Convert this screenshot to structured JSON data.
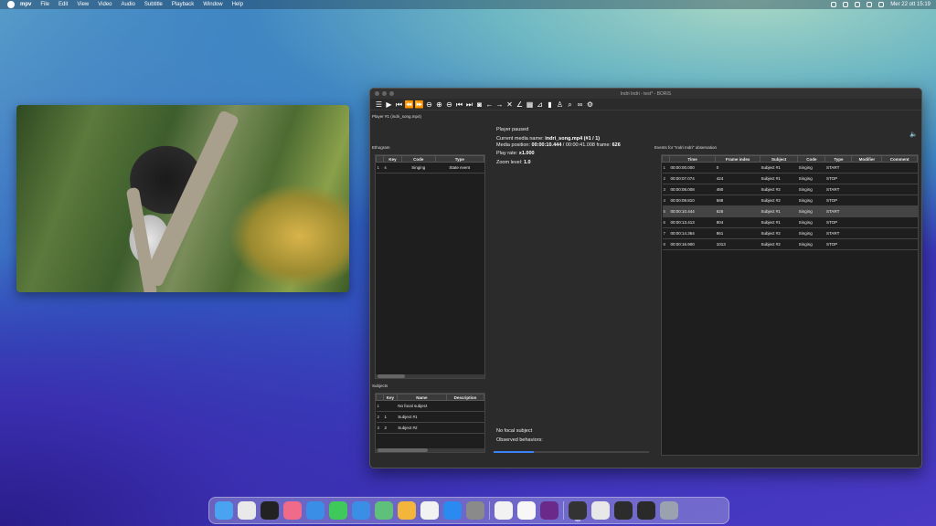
{
  "menubar": {
    "app": "mpv",
    "items": [
      "File",
      "Edit",
      "View",
      "Video",
      "Audio",
      "Subtitle",
      "Playback",
      "Window",
      "Help"
    ],
    "datetime": "Mer 22 ott  15:19"
  },
  "window": {
    "title": "Indri Indri - test* - BORIS",
    "player_label": "Player #1 (indri_song.mp4)",
    "toolbar_icons": [
      "list-icon",
      "play-icon",
      "skip-start-icon",
      "rewind-icon",
      "fast-forward-icon",
      "minus-circle-icon",
      "plus-circle-icon",
      "minus-circle-icon",
      "skip-back-icon",
      "skip-forward-icon",
      "camera-icon",
      "arrow-left-icon",
      "arrow-right-icon",
      "close-x-icon",
      "angle-icon",
      "table-icon",
      "chart-icon",
      "bar-chart-icon",
      "person-icon",
      "search-icon",
      "binoculars-icon",
      "settings-icon"
    ]
  },
  "ethogram": {
    "label": "Ethogram",
    "columns": [
      "Key",
      "Code",
      "Type"
    ],
    "rows": [
      {
        "n": "1",
        "key": "s",
        "code": "Singing",
        "type": "State event"
      }
    ]
  },
  "subjects": {
    "label": "Subjects",
    "columns": [
      "Key",
      "Name",
      "Description"
    ],
    "rows": [
      {
        "n": "1",
        "key": "",
        "name": "No focal subject",
        "desc": ""
      },
      {
        "n": "2",
        "key": "1",
        "name": "Subject #1",
        "desc": ""
      },
      {
        "n": "3",
        "key": "2",
        "name": "Subject #2",
        "desc": ""
      }
    ]
  },
  "info": {
    "status": "Player paused",
    "media_name_label": "Current media name:",
    "media_name": "indri_song.mp4 (#1 / 1)",
    "media_position_label": "Media position:",
    "media_position": "00:00:10.444",
    "media_duration": "/ 00:00:41.008 frame:",
    "frame": "626",
    "play_rate_label": "Play rate:",
    "play_rate": "x1.000",
    "zoom_label": "Zoom level:",
    "zoom": "1.0",
    "focal_subject": "No focal subject",
    "observed": "Observed behaviors:"
  },
  "events": {
    "label": "Events for \"Indri Indri\" observation",
    "columns": [
      "Time",
      "Frame index",
      "Subject",
      "Code",
      "Type",
      "Modifier",
      "Comment"
    ],
    "rows": [
      {
        "n": "1",
        "time": "00:00:00.000",
        "frame": "0",
        "subject": "Subject #1",
        "code": "Singing",
        "type": "START",
        "modifier": "",
        "comment": ""
      },
      {
        "n": "2",
        "time": "00:00:07.074",
        "frame": "424",
        "subject": "Subject #1",
        "code": "Singing",
        "type": "STOP",
        "modifier": "",
        "comment": ""
      },
      {
        "n": "3",
        "time": "00:00:08.008",
        "frame": "480",
        "subject": "Subject #2",
        "code": "Singing",
        "type": "START",
        "modifier": "",
        "comment": ""
      },
      {
        "n": "4",
        "time": "00:00:09.810",
        "frame": "588",
        "subject": "Subject #2",
        "code": "Singing",
        "type": "STOP",
        "modifier": "",
        "comment": ""
      },
      {
        "n": "5",
        "time": "00:00:10.444",
        "frame": "626",
        "subject": "Subject #1",
        "code": "Singing",
        "type": "START",
        "modifier": "",
        "comment": ""
      },
      {
        "n": "6",
        "time": "00:00:13.413",
        "frame": "804",
        "subject": "Subject #1",
        "code": "Singing",
        "type": "STOP",
        "modifier": "",
        "comment": ""
      },
      {
        "n": "7",
        "time": "00:00:14.364",
        "frame": "861",
        "subject": "Subject #2",
        "code": "Singing",
        "type": "START",
        "modifier": "",
        "comment": ""
      },
      {
        "n": "8",
        "time": "00:00:16.900",
        "frame": "1013",
        "subject": "Subject #2",
        "code": "Singing",
        "type": "STOP",
        "modifier": "",
        "comment": ""
      }
    ],
    "selected_row": 4
  },
  "dock": {
    "apps": [
      {
        "name": "finder-icon",
        "color": "#4aa3f0"
      },
      {
        "name": "chrome-icon",
        "color": "#e9e9e9"
      },
      {
        "name": "terminal-icon",
        "color": "#222222"
      },
      {
        "name": "launchpad-icon",
        "color": "#f06a8a"
      },
      {
        "name": "safari-icon",
        "color": "#3a8ee6"
      },
      {
        "name": "messages-icon",
        "color": "#3fc95a"
      },
      {
        "name": "mail-icon",
        "color": "#3a8ee6"
      },
      {
        "name": "maps-icon",
        "color": "#5ec07a"
      },
      {
        "name": "photos-icon",
        "color": "#f3b63a"
      },
      {
        "name": "reminders-icon",
        "color": "#f2f2f2"
      },
      {
        "name": "app-store-icon",
        "color": "#2a8af0"
      },
      {
        "name": "system-settings-icon",
        "color": "#8a8a8a"
      },
      {
        "name": "textedit-icon",
        "color": "#f2f2f2"
      },
      {
        "name": "document-icon",
        "color": "#f7f7f7"
      },
      {
        "name": "mpv-icon",
        "color": "#6b2a8a"
      },
      {
        "name": "window-thumbnail-1",
        "color": "#333333",
        "label": "mpv"
      },
      {
        "name": "document-icon-2",
        "color": "#e8e8e8"
      },
      {
        "name": "window-thumbnail-2",
        "color": "#2c2c2c"
      },
      {
        "name": "window-thumbnail-3",
        "color": "#2a2a2a"
      },
      {
        "name": "trash-icon",
        "color": "#9aa2b0"
      }
    ]
  }
}
